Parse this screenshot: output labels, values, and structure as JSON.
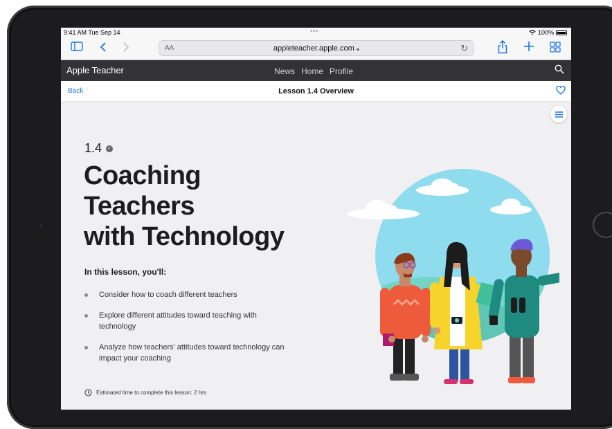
{
  "status_bar": {
    "time": "9:41 AM  Tue Sep 14",
    "battery": "100%"
  },
  "browser": {
    "address_prefix": "AA",
    "url": "appleteacher.apple.com"
  },
  "site_nav": {
    "brand": "Apple Teacher",
    "links": [
      "News",
      "Home",
      "Profile"
    ]
  },
  "lesson_bar": {
    "back": "Back",
    "title": "Lesson 1.4 Overview"
  },
  "lesson": {
    "number": "1.4",
    "title_lines": [
      "Coaching",
      "Teachers",
      "with Technology"
    ],
    "intro": "In this lesson, you'll:",
    "objectives": [
      "Consider how to coach different teachers",
      "Explore different attitudes toward teaching with technology",
      "Analyze how teachers' attitudes toward technology can impact your coaching"
    ],
    "estimate": "Estimated time to complete this lesson: 2 hrs"
  },
  "colors": {
    "accent": "#1a73e8",
    "nav_bg": "#333335",
    "sky": "#8fdcef",
    "ground": "#74d4c6"
  },
  "icons": [
    "sidebar-icon",
    "back-chevron-icon",
    "forward-chevron-icon",
    "share-icon",
    "new-tab-icon",
    "tabs-icon",
    "search-icon",
    "heart-icon",
    "menu-icon",
    "clock-icon",
    "check-icon",
    "wifi-icon",
    "lock-icon",
    "reload-icon"
  ]
}
